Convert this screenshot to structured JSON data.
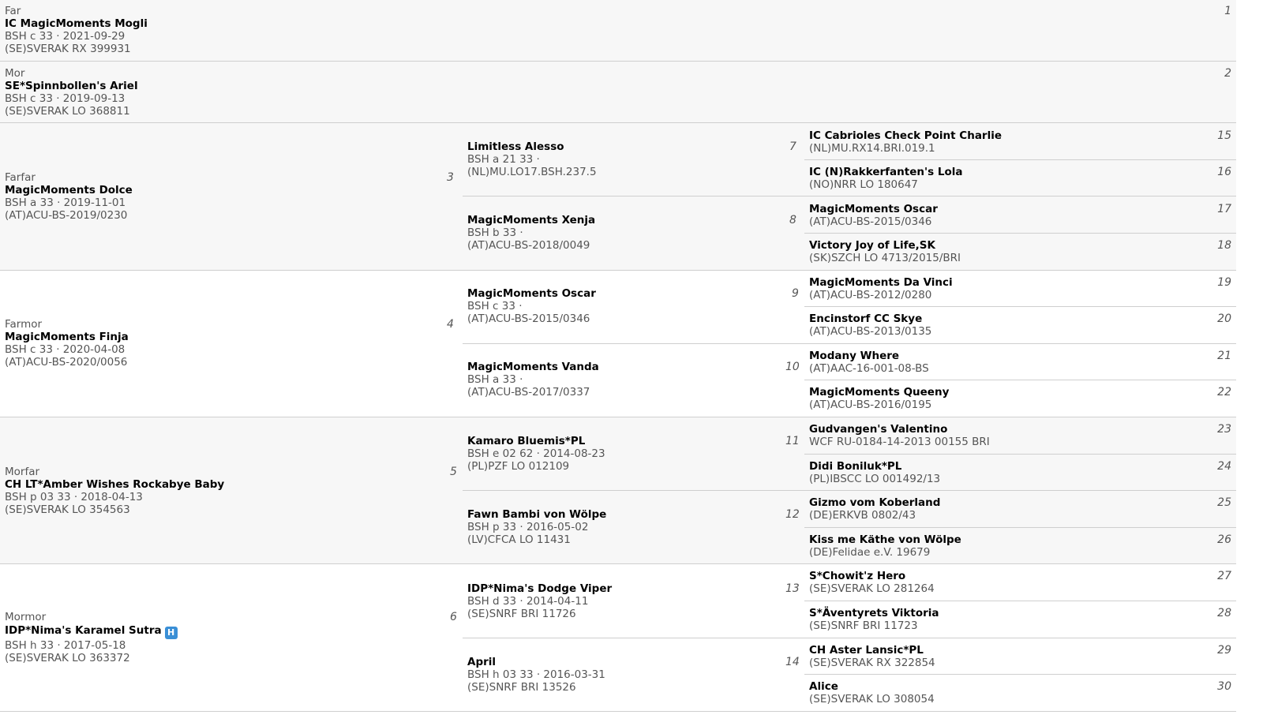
{
  "parents": [
    {
      "role": "Far",
      "name": "IC MagicMoments Mogli",
      "meta": "BSH c 33 · 2021-09-29",
      "reg": "(SE)SVERAK RX 399931",
      "num": "1"
    },
    {
      "role": "Mor",
      "name": "SE*Spinnbollen's Ariel",
      "meta": "BSH c 33 · 2019-09-13",
      "reg": "(SE)SVERAK LO 368811",
      "num": "2"
    }
  ],
  "grandparents": [
    {
      "role": "Farfar",
      "name": "MagicMoments Dolce",
      "meta": "BSH a 33 · 2019-11-01",
      "reg": "(AT)ACU-BS-2019/0230",
      "num": "3"
    },
    {
      "role": "Farmor",
      "name": "MagicMoments Finja",
      "meta": "BSH c 33 · 2020-04-08",
      "reg": "(AT)ACU-BS-2020/0056",
      "num": "4"
    },
    {
      "role": "Morfar",
      "name": "CH LT*Amber Wishes Rockabye Baby",
      "meta": "BSH p 03 33 · 2018-04-13",
      "reg": "(SE)SVERAK LO 354563",
      "num": "5"
    },
    {
      "role": "Mormor",
      "name": "IDP*Nima's Karamel Sutra",
      "meta": "BSH h 33 · 2017-05-18",
      "reg": "(SE)SVERAK LO 363372",
      "num": "6",
      "badge": "H"
    }
  ],
  "great_grandparents": [
    {
      "name": "Limitless Alesso",
      "meta": "BSH a 21 33 ·",
      "reg": "(NL)MU.LO17.BSH.237.5",
      "num": "7"
    },
    {
      "name": "MagicMoments Xenja",
      "meta": "BSH b 33 ·",
      "reg": "(AT)ACU-BS-2018/0049",
      "num": "8"
    },
    {
      "name": "MagicMoments Oscar",
      "meta": "BSH c 33 ·",
      "reg": "(AT)ACU-BS-2015/0346",
      "num": "9"
    },
    {
      "name": "MagicMoments Vanda",
      "meta": "BSH a 33 ·",
      "reg": "(AT)ACU-BS-2017/0337",
      "num": "10"
    },
    {
      "name": "Kamaro Bluemis*PL",
      "meta": "BSH e 02 62 · 2014-08-23",
      "reg": "(PL)PZF LO 012109",
      "num": "11"
    },
    {
      "name": "Fawn Bambi von Wölpe",
      "meta": "BSH p 33 · 2016-05-02",
      "reg": "(LV)CFCA LO 11431",
      "num": "12"
    },
    {
      "name": "IDP*Nima's Dodge Viper",
      "meta": "BSH d 33 · 2014-04-11",
      "reg": "(SE)SNRF BRI 11726",
      "num": "13"
    },
    {
      "name": "April",
      "meta": "BSH h 03 33 · 2016-03-31",
      "reg": "(SE)SNRF BRI 13526",
      "num": "14"
    }
  ],
  "great_great_grandparents": [
    {
      "name": "IC Cabrioles Check Point Charlie",
      "reg": "(NL)MU.RX14.BRI.019.1",
      "num": "15"
    },
    {
      "name": "IC (N)Rakkerfanten's Lola",
      "reg": "(NO)NRR LO 180647",
      "num": "16"
    },
    {
      "name": "MagicMoments Oscar",
      "reg": "(AT)ACU-BS-2015/0346",
      "num": "17"
    },
    {
      "name": "Victory Joy of Life,SK",
      "reg": "(SK)SZCH LO 4713/2015/BRI",
      "num": "18"
    },
    {
      "name": "MagicMoments Da Vinci",
      "reg": "(AT)ACU-BS-2012/0280",
      "num": "19"
    },
    {
      "name": "Encinstorf CC Skye",
      "reg": "(AT)ACU-BS-2013/0135",
      "num": "20"
    },
    {
      "name": "Modany Where",
      "reg": "(AT)AAC-16-001-08-BS",
      "num": "21"
    },
    {
      "name": "MagicMoments Queeny",
      "reg": "(AT)ACU-BS-2016/0195",
      "num": "22"
    },
    {
      "name": "Gudvangen's Valentino",
      "reg": "WCF RU-0184-14-2013 00155 BRI",
      "num": "23"
    },
    {
      "name": "Didi Boniluk*PL",
      "reg": "(PL)IBSCC LO 001492/13",
      "num": "24"
    },
    {
      "name": "Gizmo vom Koberland",
      "reg": "(DE)ERKVB 0802/43",
      "num": "25"
    },
    {
      "name": "Kiss me Käthe von Wölpe",
      "reg": "(DE)Felidae e.V. 19679",
      "num": "26"
    },
    {
      "name": "S*Chowit'z Hero",
      "reg": "(SE)SVERAK LO 281264",
      "num": "27"
    },
    {
      "name": "S*Äventyrets Viktoria",
      "reg": "(SE)SNRF BRI 11723",
      "num": "28"
    },
    {
      "name": "CH Aster Lansic*PL",
      "reg": "(SE)SVERAK RX 322854",
      "num": "29"
    },
    {
      "name": "Alice",
      "reg": "(SE)SVERAK LO 308054",
      "num": "30"
    }
  ]
}
